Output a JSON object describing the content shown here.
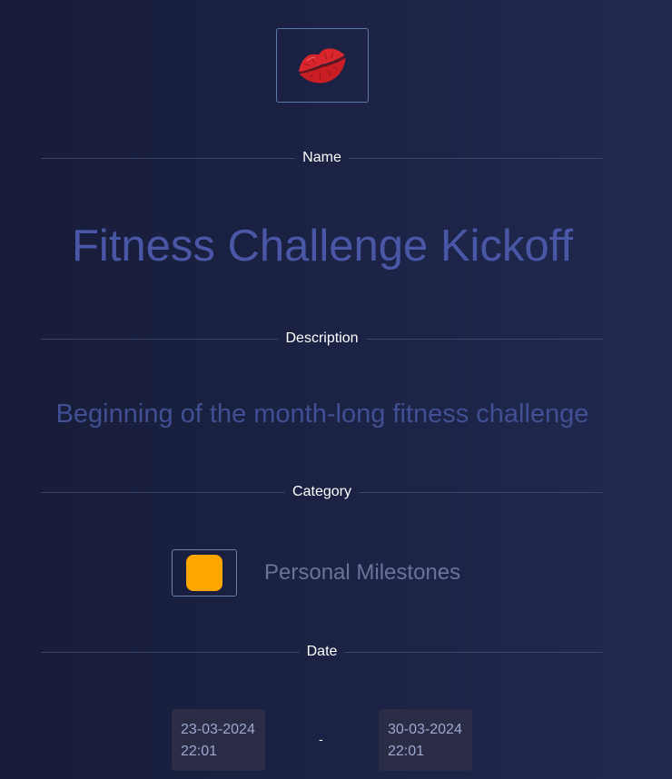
{
  "event": {
    "icon": "kiss-mark-icon",
    "name_label": "Name",
    "name": "Fitness Challenge Kickoff",
    "description_label": "Description",
    "description": "Beginning of the month-long fitness challenge",
    "category_label": "Category",
    "category": {
      "name": "Personal Milestones",
      "color": "#ffa600"
    },
    "date_label": "Date",
    "start": {
      "date": "23-03-2024",
      "time": "22:01"
    },
    "separator": "-",
    "end": {
      "date": "30-03-2024",
      "time": "22:01"
    }
  },
  "colors": {
    "title": "#4957a6",
    "description": "#414f93",
    "lips": "#d8262c"
  }
}
